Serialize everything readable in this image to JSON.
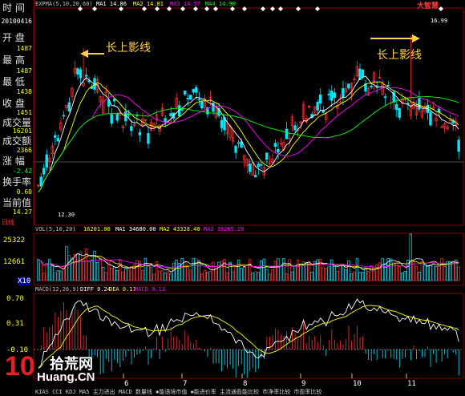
{
  "info": {
    "time_label": "时 间",
    "date": "20100416",
    "open_label": "开 盘",
    "open": "1487",
    "high_label": "最 高",
    "high": "1487",
    "low_label": "最 低",
    "low": "1438",
    "close_label": "收 盘",
    "close": "1451",
    "vol_label": "成交量",
    "vol": "16201",
    "amt_label": "成交额",
    "amt": "2366",
    "chg_label": "涨 幅",
    "chg": "-2.42",
    "turn_label": "换手率",
    "turn": "0.60",
    "cur_label": "当前值",
    "cur": "14.27",
    "period": "日线"
  },
  "price_panel": {
    "header": "EXPMA(5,10,20,60)",
    "ma1": "MA1 14.86",
    "ma2": "MA2 14.81",
    "ma3": "MA3 14.57",
    "ma4": "MA4 14.90",
    "high_mark": "16.99",
    "low_mark": "12.30",
    "annot_left": "长上影线",
    "annot_right": "长上影线"
  },
  "volume_panel": {
    "header": "VOL(5,10,20)",
    "v": "16201.00",
    "ma1": "MA1 34680.00",
    "ma2": "MA2 43328.40",
    "ma3": "MA3 36265.20",
    "tick_top": "25322",
    "tick_mid": "12661",
    "tick_unit": "X10"
  },
  "macd_panel": {
    "header": "MACD(12,26,9)",
    "diff": "DIFF 0.24",
    "dea": "DEA 0.17",
    "macd": "MACD 0.13",
    "tick_top": "0.70",
    "tick_mid": "0.31",
    "tick_low": "-0.10"
  },
  "months": [
    "6",
    "7",
    "8",
    "9",
    "10",
    "11"
  ],
  "bottom_tabs": "KIAS  CCI  KDJ  MA5  主力进出  MACD  数量线  ✱能语境市值  ✱能进价率  主流通盈能比较  市净率比较  市盈率比较",
  "logo": {
    "ten": "10",
    "name": "拾荒网",
    "site": "Huang.CN"
  },
  "brand": "大智慧",
  "colors": {
    "up": "#ff3232",
    "down": "#00e6ff",
    "ma1": "#ffffff",
    "ma2": "#ffff00",
    "ma3": "#ff00ff",
    "ma4": "#00ff00",
    "frame": "#8a0000",
    "annot": "#ffd24a"
  },
  "chart_data": {
    "type": "candlestick",
    "title": "",
    "xlabel": "",
    "ylabel": "",
    "x_ticks": [
      "6",
      "7",
      "8",
      "9",
      "10",
      "11"
    ],
    "price_range": [
      12.3,
      16.99
    ],
    "price_high_label": 16.99,
    "price_low_label": 12.3,
    "volume_ticks": [
      25322,
      12661
    ],
    "macd_ticks": [
      0.7,
      0.31,
      -0.1
    ],
    "last": {
      "open": 14.87,
      "high": 14.87,
      "low": 14.38,
      "close": 14.51,
      "volume": 16201,
      "change_pct": -2.42
    }
  }
}
